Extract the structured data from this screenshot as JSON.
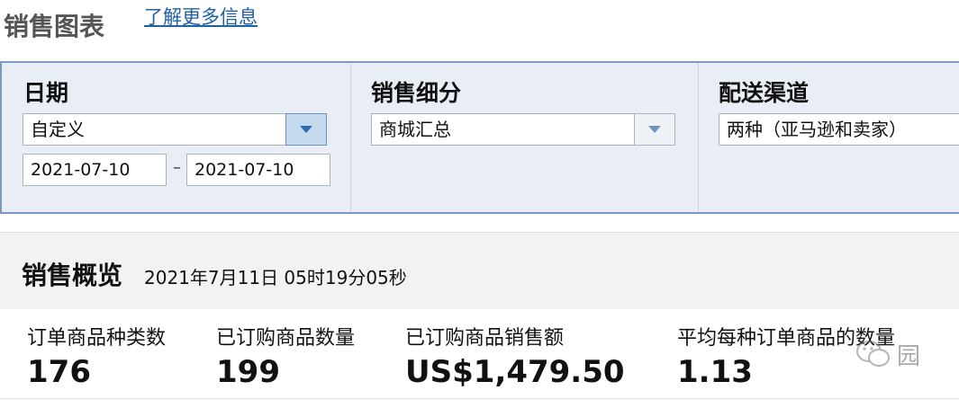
{
  "header": {
    "title": "销售图表",
    "learn_more": "了解更多信息"
  },
  "filters": {
    "date": {
      "label": "日期",
      "selected": "自定义",
      "start": "2021-07-10",
      "end": "2021-07-10",
      "separator": "–"
    },
    "segment": {
      "label": "销售细分",
      "selected": "商城汇总"
    },
    "channel": {
      "label": "配送渠道",
      "selected": "两种（亚马逊和卖家）"
    }
  },
  "overview": {
    "title": "销售概览",
    "timestamp": "2021年7月11日 05时19分05秒",
    "metrics": [
      {
        "label": "订单商品种类数",
        "value": "176"
      },
      {
        "label": "已订购商品数量",
        "value": "199"
      },
      {
        "label": "已订购商品销售额",
        "value": "US$1,479.50"
      },
      {
        "label": "平均每种订单商品的数量",
        "value": "1.13"
      }
    ]
  },
  "watermark": {
    "text": "园"
  },
  "colors": {
    "link": "#1f5fa8",
    "panel_bg": "#e9eef6",
    "panel_border": "#7a9bbd",
    "dropdown_active": "#c5d9ef"
  }
}
